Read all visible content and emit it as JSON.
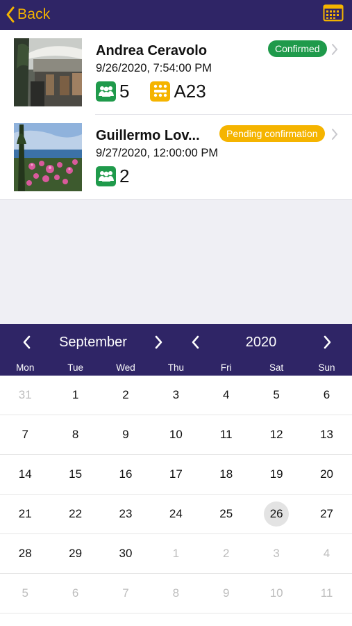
{
  "header": {
    "back_label": "Back",
    "icons": {
      "back": "chevron-left-icon",
      "calendar": "calendar-icon"
    },
    "colors": {
      "bar": "#2f2566",
      "accent": "#f4b400"
    }
  },
  "reservations": [
    {
      "name": "Andrea Ceravolo",
      "datetime": "9/26/2020, 7:54:00 PM",
      "status": "Confirmed",
      "status_color": "#1f9a4b",
      "guests": "5",
      "table": "A23",
      "thumb": "restaurant-terrace-image"
    },
    {
      "name": "Guillermo Lov...",
      "datetime": "9/27/2020, 12:00:00 PM",
      "status": "Pending confirmation",
      "status_color": "#f5b400",
      "guests": "2",
      "thumb": "seaside-flowers-image"
    }
  ],
  "calendar": {
    "month": "September",
    "year": "2020",
    "weekdays": [
      "Mon",
      "Tue",
      "Wed",
      "Thu",
      "Fri",
      "Sat",
      "Sun"
    ],
    "weeks": [
      [
        "31",
        "1",
        "2",
        "3",
        "4",
        "5",
        "6"
      ],
      [
        "7",
        "8",
        "9",
        "10",
        "11",
        "12",
        "13"
      ],
      [
        "14",
        "15",
        "16",
        "17",
        "18",
        "19",
        "20"
      ],
      [
        "21",
        "22",
        "23",
        "24",
        "25",
        "26",
        "27"
      ],
      [
        "28",
        "29",
        "30",
        "1",
        "2",
        "3",
        "4"
      ],
      [
        "5",
        "6",
        "7",
        "8",
        "9",
        "10",
        "11"
      ]
    ],
    "muted": [
      [
        0,
        0
      ],
      [
        4,
        3
      ],
      [
        4,
        4
      ],
      [
        4,
        5
      ],
      [
        4,
        6
      ],
      [
        5,
        0
      ],
      [
        5,
        1
      ],
      [
        5,
        2
      ],
      [
        5,
        3
      ],
      [
        5,
        4
      ],
      [
        5,
        5
      ],
      [
        5,
        6
      ]
    ],
    "selected": [
      3,
      5
    ]
  }
}
